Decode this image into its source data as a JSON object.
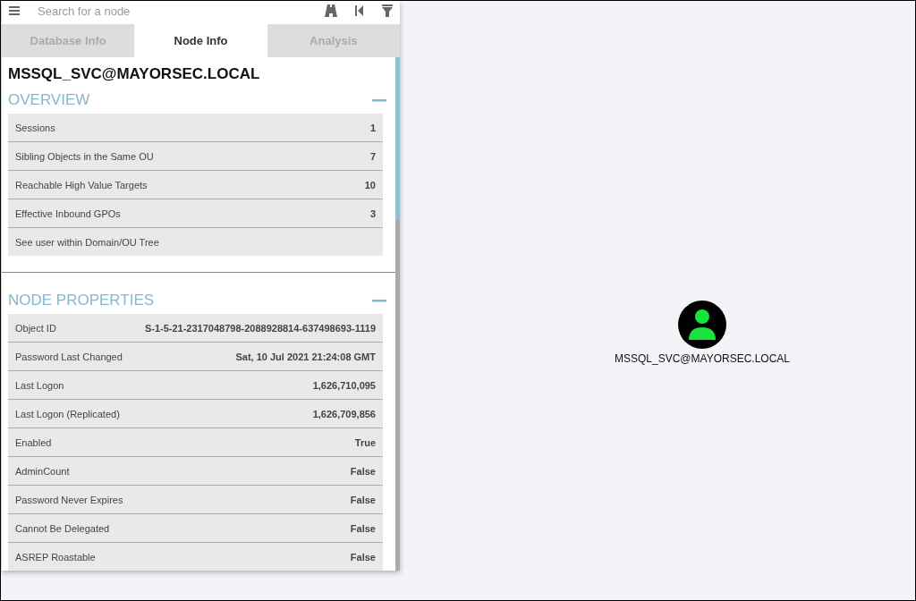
{
  "search": {
    "placeholder": "Search for a node"
  },
  "tabs": [
    {
      "label": "Database Info",
      "selected": false
    },
    {
      "label": "Node Info",
      "selected": true
    },
    {
      "label": "Analysis",
      "selected": false
    }
  ],
  "node_title": "MSSQL_SVC@MAYORSEC.LOCAL",
  "sections": [
    {
      "title": "OVERVIEW",
      "rows": [
        {
          "label": "Sessions",
          "value": "1"
        },
        {
          "label": "Sibling Objects in the Same OU",
          "value": "7"
        },
        {
          "label": "Reachable High Value Targets",
          "value": "10"
        },
        {
          "label": "Effective Inbound GPOs",
          "value": "3"
        },
        {
          "label": "See user within Domain/OU Tree"
        }
      ]
    },
    {
      "title": "NODE PROPERTIES",
      "rows": [
        {
          "label": "Object ID",
          "value": "S-1-5-21-2317048798-2088928814-637498693-1119"
        },
        {
          "label": "Password Last Changed",
          "value": "Sat, 10 Jul 2021 21:24:08 GMT"
        },
        {
          "label": "Last Logon",
          "value": "1,626,710,095"
        },
        {
          "label": "Last Logon (Replicated)",
          "value": "1,626,709,856"
        },
        {
          "label": "Enabled",
          "value": "True"
        },
        {
          "label": "AdminCount",
          "value": "False"
        },
        {
          "label": "Password Never Expires",
          "value": "False"
        },
        {
          "label": "Cannot Be Delegated",
          "value": "False"
        },
        {
          "label": "ASREP Roastable",
          "value": "False"
        }
      ]
    }
  ],
  "graph": {
    "node": {
      "label": "MSSQL_SVC@MAYORSEC.LOCAL",
      "color": "#17e33a"
    }
  }
}
